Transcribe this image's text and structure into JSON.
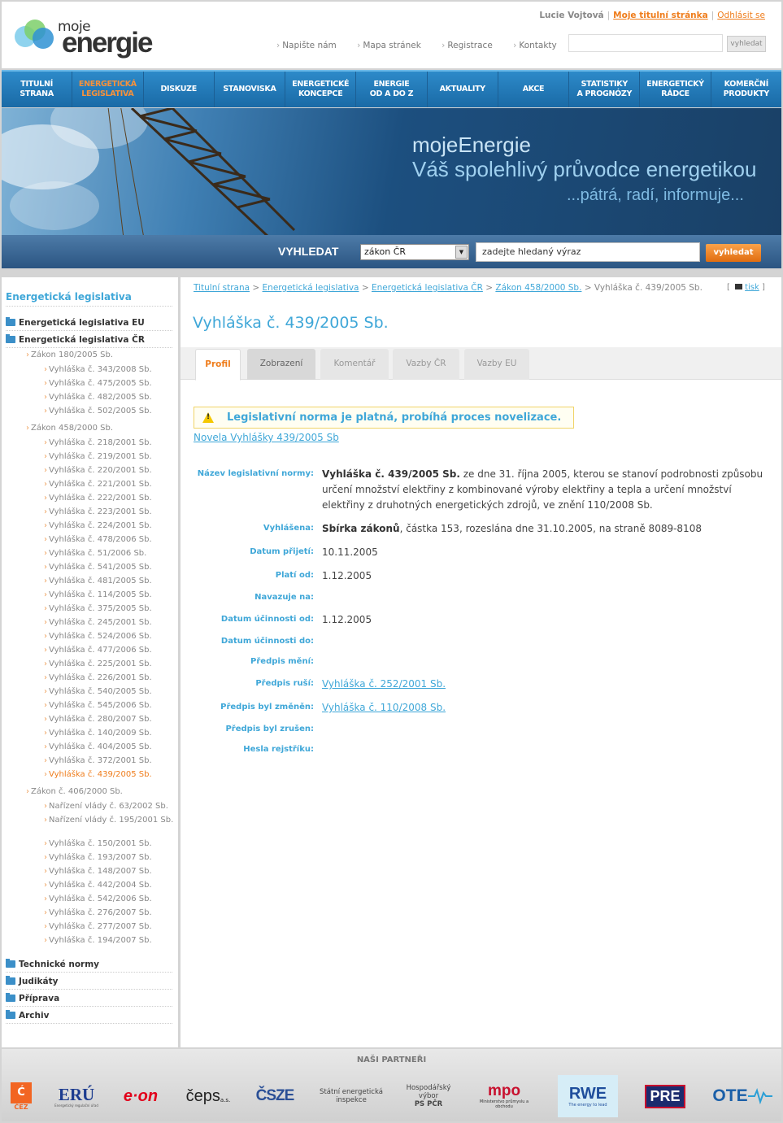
{
  "logo": {
    "moje": "moje",
    "energie": "energie"
  },
  "userbar": {
    "user": "Lucie Vojtová",
    "home": "Moje titulní stránka",
    "logout": "Odhlásit se"
  },
  "toplinks": [
    "Napište nám",
    "Mapa stránek",
    "Registrace",
    "Kontakty"
  ],
  "topsearch": {
    "button": "vyhledat"
  },
  "nav": [
    {
      "line1": "Titulní",
      "line2": "strana"
    },
    {
      "line1": "Energetická",
      "line2": "legislativa",
      "active": true
    },
    {
      "line1": "Diskuze",
      "line2": ""
    },
    {
      "line1": "Stanoviska",
      "line2": ""
    },
    {
      "line1": "Energetické",
      "line2": "koncepce"
    },
    {
      "line1": "Energie",
      "line2": "od A do Z"
    },
    {
      "line1": "Aktuality",
      "line2": ""
    },
    {
      "line1": "Akce",
      "line2": ""
    },
    {
      "line1": "Statistiky",
      "line2": "a prognózy"
    },
    {
      "line1": "Energetický",
      "line2": "rádce"
    },
    {
      "line1": "Komerční",
      "line2": "produkty"
    }
  ],
  "banner": {
    "line1": "mojeEnergie",
    "line2": "Váš spolehlivý průvodce energetikou",
    "line3": "...pátrá, radí, informuje..."
  },
  "search": {
    "label": "VYHLEDAT",
    "select": "zákon ČR",
    "placeholder": "zadejte hledaný výraz",
    "button": "vyhledat"
  },
  "sidebar": {
    "title": "Energetická legislativa",
    "top1": "Energetická legislativa EU",
    "top2": "Energetická legislativa ČR",
    "group1": {
      "title": "Zákon 180/2005 Sb.",
      "items": [
        "Vyhláška č. 343/2008 Sb.",
        "Vyhláška č. 475/2005 Sb.",
        "Vyhláška č. 482/2005 Sb.",
        "Vyhláška č. 502/2005 Sb."
      ]
    },
    "group2": {
      "title": "Zákon 458/2000 Sb.",
      "items": [
        "Vyhláška č. 218/2001 Sb.",
        "Vyhláška č. 219/2001 Sb.",
        "Vyhláška č. 220/2001 Sb.",
        "Vyhláška č. 221/2001 Sb.",
        "Vyhláška č. 222/2001 Sb.",
        "Vyhláška č. 223/2001 Sb.",
        "Vyhláška č. 224/2001 Sb.",
        "Vyhláška č. 478/2006 Sb.",
        "Vyhláška č. 51/2006 Sb.",
        "Vyhláška č. 541/2005 Sb.",
        "Vyhláška č. 481/2005 Sb.",
        "Vyhláška č. 114/2005 Sb.",
        "Vyhláška č. 375/2005 Sb.",
        "Vyhláška č. 245/2001 Sb.",
        "Vyhláška č. 524/2006 Sb.",
        "Vyhláška č. 477/2006 Sb.",
        "Vyhláška č. 225/2001 Sb.",
        "Vyhláška č. 226/2001 Sb.",
        "Vyhláška č. 540/2005 Sb.",
        "Vyhláška č. 545/2006 Sb.",
        "Vyhláška č. 280/2007 Sb.",
        "Vyhláška č. 140/2009 Sb.",
        "Vyhláška č. 404/2005 Sb.",
        "Vyhláška č. 372/2001 Sb.",
        "Vyhláška č. 439/2005 Sb."
      ]
    },
    "group3": {
      "title": "Zákon č. 406/2000 Sb.",
      "items": [
        "Nařízení vlády č. 63/2002 Sb.",
        "Nařízení vlády č. 195/2001 Sb.",
        "Vyhláška č. 150/2001 Sb.",
        "Vyhláška č. 193/2007 Sb.",
        "Vyhláška č. 148/2007 Sb.",
        "Vyhláška č. 442/2004 Sb.",
        "Vyhláška č. 542/2006 Sb.",
        "Vyhláška č. 276/2007 Sb.",
        "Vyhláška č. 277/2007 Sb.",
        "Vyhláška č. 194/2007 Sb."
      ]
    },
    "bottom": [
      "Technické normy",
      "Judikáty",
      "Příprava",
      "Archiv"
    ]
  },
  "breadcrumb": {
    "c1": "Titulní strana",
    "c2": "Energetická legislativa",
    "c3": "Energetická legislativa ČR",
    "c4": "Zákon 458/2000 Sb.",
    "current": "Vyhláška č. 439/2005 Sb."
  },
  "print": "tisk",
  "page_title": "Vyhláška č. 439/2005 Sb.",
  "tabs": [
    "Profil",
    "Zobrazení",
    "Komentář",
    "Vazby ČR",
    "Vazby EU"
  ],
  "alert": "Legislativní norma je platná, probíhá proces novelizace.",
  "novela": "Novela Vyhlášky 439/2005 Sb",
  "fields": {
    "nazev_label": "Název legislativní normy:",
    "nazev_bold": "Vyhláška č. 439/2005 Sb.",
    "nazev_rest": " ze dne 31. října 2005, kterou se stanoví podrobnosti způsobu určení množství elektřiny z kombinované výroby elektřiny a tepla a určení množství elektřiny z druhotných energetických zdrojů, ve znění 110/2008 Sb.",
    "vyhlasena_label": "Vyhlášena:",
    "vyhlasena_bold": "Sbírka zákonů",
    "vyhlasena_rest": ", částka 153, rozeslána dne 31.10.2005, na straně 8089-8108",
    "prijeti_label": "Datum přijetí:",
    "prijeti": "10.11.2005",
    "plati_label": "Platí od:",
    "plati": "1.12.2005",
    "navazuje_label": "Navazuje na:",
    "ucinnost_od_label": "Datum účinnosti od:",
    "ucinnost_od": "1.12.2005",
    "ucinnost_do_label": "Datum účinnosti do:",
    "meni_label": "Předpis mění:",
    "rusi_label": "Předpis ruší:",
    "rusi": "Vyhláška č. 252/2001 Sb.",
    "zmenen_label": "Předpis byl změněn:",
    "zmenen": "Vyhláška č. 110/2008 Sb.",
    "zrusen_label": "Předpis byl zrušen:",
    "hesla_label": "Hesla rejstříku:"
  },
  "partners": {
    "title": "NAŠI PARTNEŘI",
    "cez": "ČEZ",
    "eru": "ERÚ",
    "eru_sub": "Energetický regulační úřad",
    "eon": "e·on",
    "ceps": "čeps",
    "ceps_sub": "a.s.",
    "csze": "ČSZE",
    "sei": "Státní energetická inspekce",
    "hv1": "Hospodářský",
    "hv2": "výbor",
    "hv3": "PS PČR",
    "mpo": "mpo",
    "mpo_sub": "Ministerstvo průmyslu a obchodu",
    "rwe": "RWE",
    "rwe_sub": "The energy to lead",
    "pre": "PRE",
    "ote": "OTE"
  }
}
